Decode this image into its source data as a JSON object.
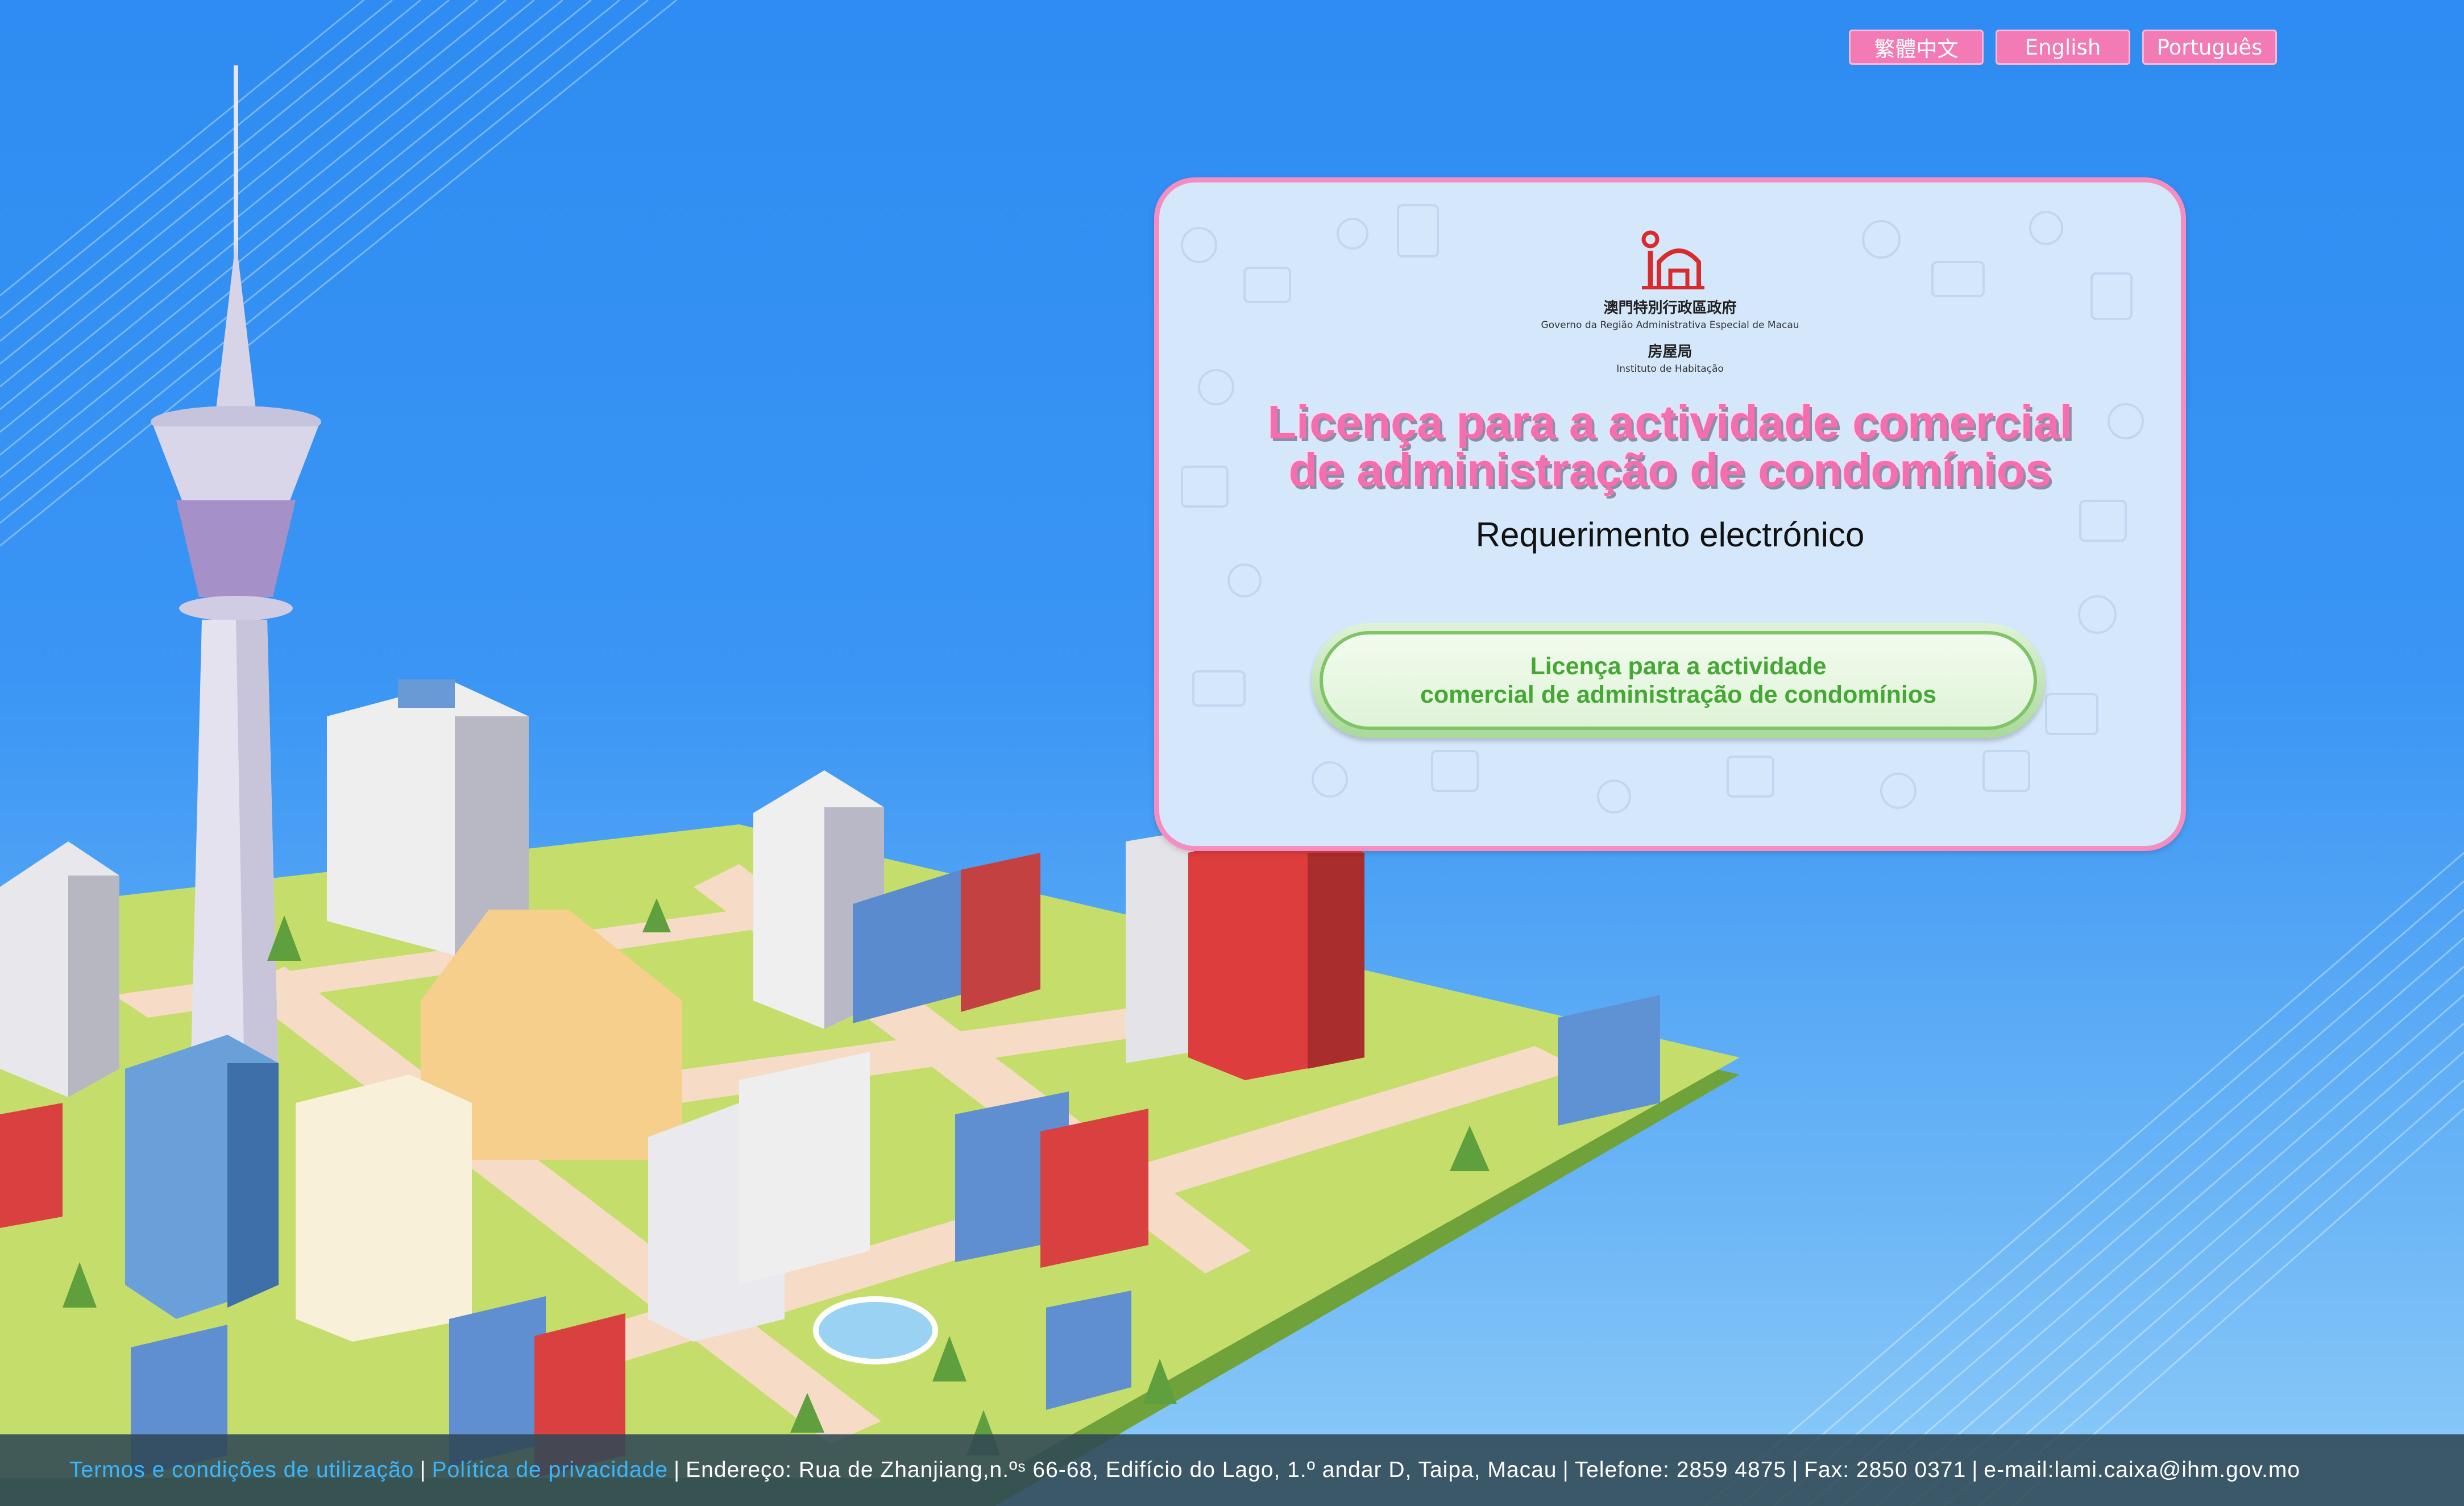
{
  "languages": [
    {
      "label": "繁體中文"
    },
    {
      "label": "English"
    },
    {
      "label": "Português"
    }
  ],
  "panel": {
    "logo": {
      "line1": "澳門特別行政區政府",
      "line2": "Governo da Região Administrativa Especial de Macau",
      "line3": "房屋局",
      "line4": "Instituto de Habitação"
    },
    "title_line1": "Licença para a actividade comercial",
    "title_line2": "de administração de condomínios",
    "subtitle": "Requerimento electrónico",
    "button_line1": "Licença para a actividade",
    "button_line2": "comercial de administração de condomínios"
  },
  "footer": {
    "terms": "Termos e condições de utilização",
    "privacy": "Política de privacidade",
    "address": "Endereço: Rua de Zhanjiang,n.ºˢ 66-68, Edifício do Lago, 1.º andar D, Taipa, Macau",
    "phone": "Telefone: 2859 4875",
    "fax": "Fax: 2850 0371",
    "email": "e-mail:lami.caixa@ihm.gov.mo"
  },
  "colors": {
    "accent_pink": "#f27ab5",
    "title_pink": "#f56fb0",
    "button_green": "#45a834",
    "link_blue": "#38b6ff"
  },
  "icons": [
    "ihm-logo-icon",
    "city-illustration"
  ]
}
